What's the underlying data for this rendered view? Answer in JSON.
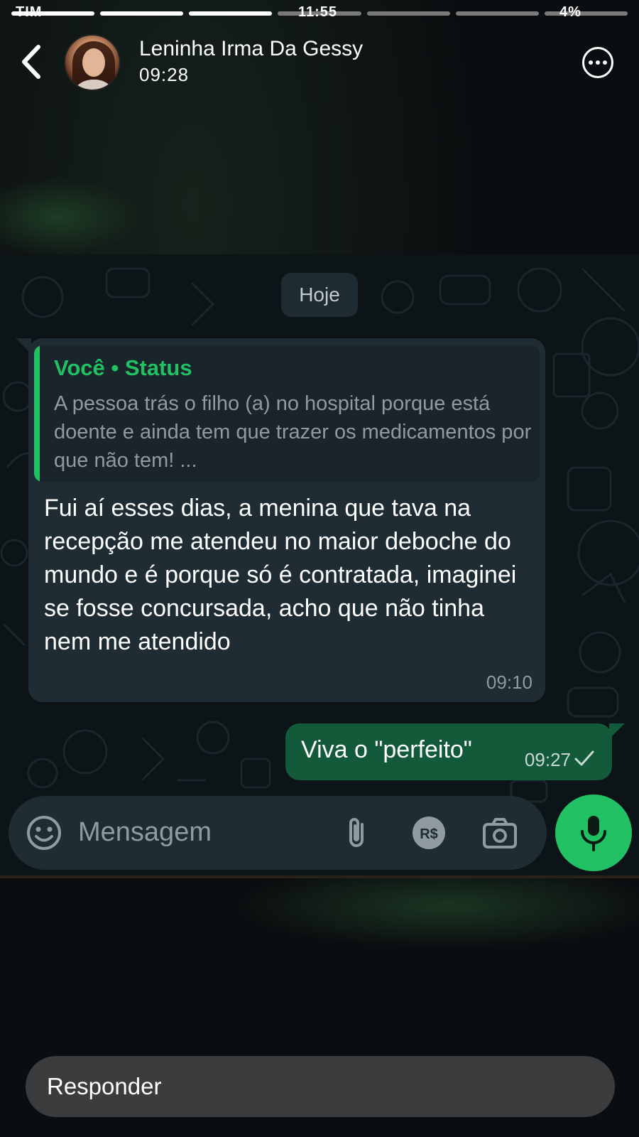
{
  "status_bar": {
    "clock": "11:55",
    "battery": "4%",
    "carrier": "TIM"
  },
  "story": {
    "segments_total": 7,
    "segments_done": 3,
    "contact_name": "Leninha Irma Da Gessy",
    "posted_time": "09:28"
  },
  "chat": {
    "day_chip": "Hoje",
    "incoming": {
      "quote_sender": "Você • Status",
      "quote_text": "A pessoa trás o filho (a) no hospital porque está doente e ainda tem que trazer os medicamentos por que não tem! ...",
      "text": "Fui aí esses dias, a menina que tava na recepção me atendeu no maior deboche do mundo e é porque só é contratada, imaginei se fosse concursada, acho que não tinha nem me atendido",
      "time": "09:10"
    },
    "outgoing": {
      "text": "Viva o \"perfeito\"",
      "time": "09:27"
    },
    "composer": {
      "placeholder": "Mensagem"
    }
  },
  "reply": {
    "placeholder": "Responder"
  },
  "colors": {
    "accent_green": "#21c063",
    "bubble_in": "#1f2c33",
    "bubble_out": "#125a3a",
    "chat_bg": "#0d1418"
  },
  "icons": [
    "back-chevron-icon",
    "more-options-icon",
    "emoji-icon",
    "attach-clip-icon",
    "pix-payment-icon",
    "camera-icon",
    "microphone-icon",
    "single-check-icon"
  ]
}
